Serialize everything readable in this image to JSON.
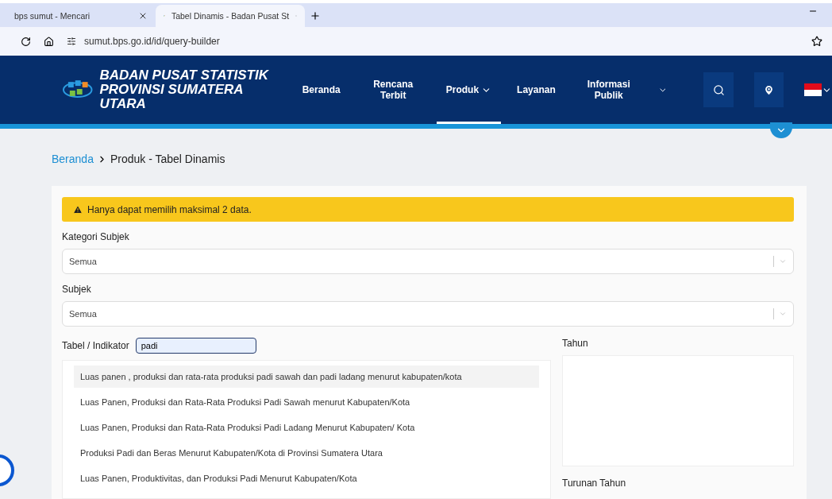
{
  "browser": {
    "tabs": [
      {
        "title": "bps sumut - Mencari",
        "selected": false
      },
      {
        "title": "Tabel Dinamis - Badan Pusat St",
        "selected": true
      }
    ],
    "url": "sumut.bps.go.id/id/query-builder"
  },
  "header": {
    "title": "BADAN PUSAT STATISTIK PROVINSI SUMATERA UTARA",
    "nav": [
      {
        "label": "Beranda",
        "dropdown": false,
        "selected": false
      },
      {
        "label": "Rencana Terbit",
        "dropdown": false,
        "selected": false
      },
      {
        "label": "Produk",
        "dropdown": true,
        "selected": true
      },
      {
        "label": "Layanan",
        "dropdown": false,
        "selected": false
      },
      {
        "label": "Informasi Publik",
        "dropdown": true,
        "selected": false
      }
    ]
  },
  "breadcrumb": [
    {
      "label": "Beranda",
      "kind": "link"
    },
    {
      "label": "Produk - Tabel Dinamis",
      "kind": "current"
    }
  ],
  "alert": "Hanya dapat memilih maksimal 2 data.",
  "selects": [
    {
      "label": "Kategori Subjek",
      "value": "Semua"
    },
    {
      "label": "Subjek",
      "value": "Semua"
    }
  ],
  "indicator": {
    "label": "Tabel / Indikator",
    "value": "padi",
    "results": [
      {
        "text": "Luas panen , produksi dan rata-rata produksi padi sawah dan padi ladang menurut kabupaten/kota",
        "selected": true
      },
      {
        "text": "Luas Panen, Produksi dan Rata-Rata Produksi Padi Sawah menurut Kabupaten/Kota",
        "selected": false
      },
      {
        "text": "Luas Panen, Produksi dan Rata-Rata Produksi Padi Ladang Menurut Kabupaten/ Kota",
        "selected": false
      },
      {
        "text": "Produksi Padi dan Beras Menurut Kabupaten/Kota di Provinsi Sumatera Utara",
        "selected": false
      },
      {
        "text": "Luas Panen, Produktivitas, dan Produksi Padi Menurut Kabupaten/Kota",
        "selected": false
      }
    ]
  },
  "year": {
    "label": "Tahun"
  },
  "derived_year": {
    "label": "Turunan Tahun"
  }
}
